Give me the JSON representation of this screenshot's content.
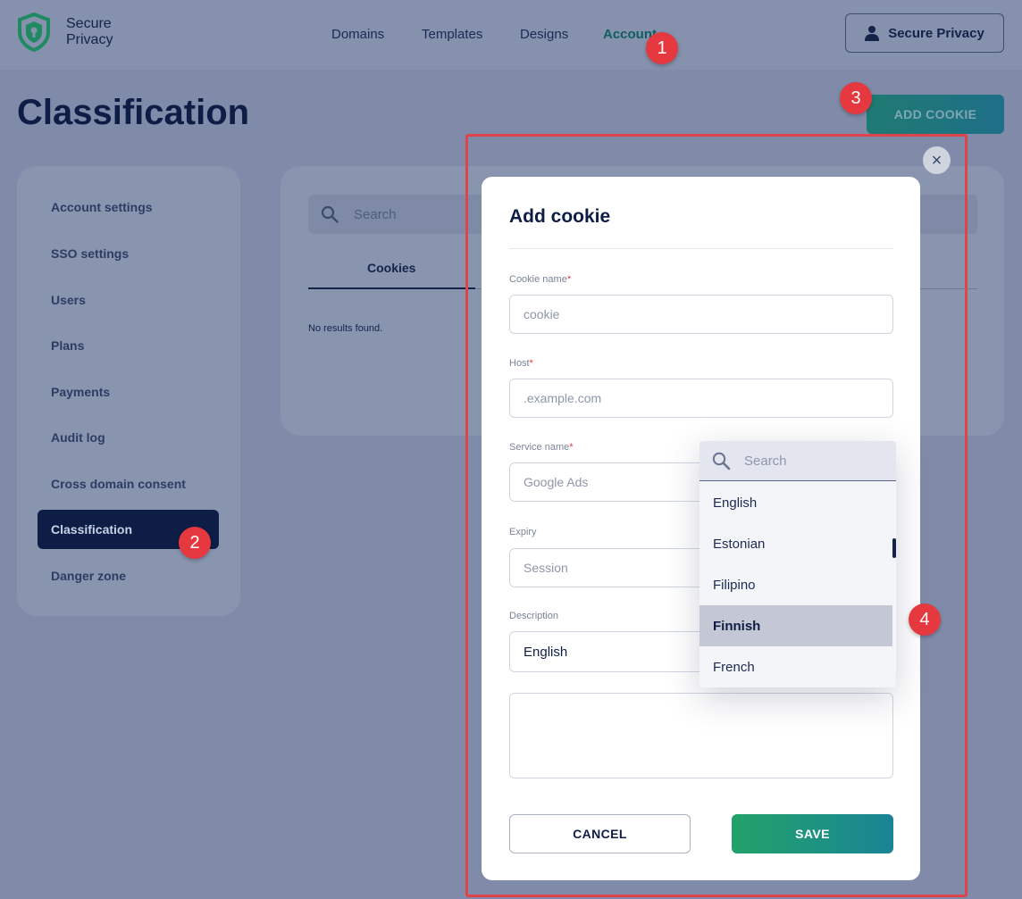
{
  "header": {
    "logo_line1": "Secure",
    "logo_line2": "Privacy",
    "nav": [
      "Domains",
      "Templates",
      "Designs",
      "Account"
    ],
    "user_button": "Secure Privacy"
  },
  "page": {
    "title": "Classification",
    "add_cookie_label": "ADD COOKIE"
  },
  "sidebar": {
    "items": [
      "Account settings",
      "SSO settings",
      "Users",
      "Plans",
      "Payments",
      "Audit log",
      "Cross domain consent",
      "Classification",
      "Danger zone"
    ],
    "active": "Classification"
  },
  "content": {
    "search_placeholder": "Search",
    "tab": "Cookies",
    "empty_text": "No results found."
  },
  "modal": {
    "title": "Add cookie",
    "close_symbol": "×",
    "cookie_name_label": "Cookie name",
    "cookie_name_placeholder": "cookie",
    "host_label": "Host",
    "host_placeholder": ".example.com",
    "service_name_label": "Service name",
    "service_name_placeholder": "Google Ads",
    "expiry_label": "Expiry",
    "expiry_placeholder": "Session",
    "description_label": "Description",
    "description_language": "English",
    "required_mark": "*",
    "cancel_label": "CANCEL",
    "save_label": "SAVE"
  },
  "dropdown": {
    "search_placeholder": "Search",
    "options": [
      "English",
      "Estonian",
      "Filipino",
      "Finnish",
      "French"
    ],
    "selected": "Finnish"
  },
  "badges": [
    "1",
    "2",
    "3",
    "4"
  ],
  "colors": {
    "primary_navy": "#0d1d46",
    "accent_teal": "#0e5f5e",
    "save_gradient_start": "#22a26a",
    "save_gradient_end": "#1a8496",
    "annotation_red": "#e5383f"
  }
}
